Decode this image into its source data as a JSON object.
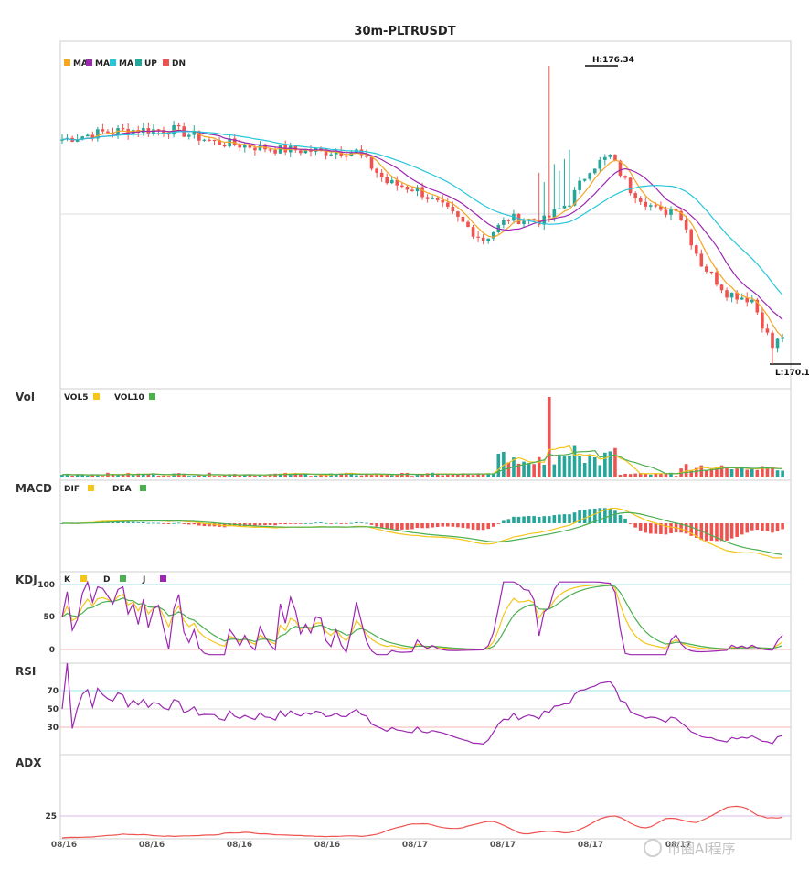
{
  "chart_data": {
    "type": "candlestick",
    "title": "30m-PLTRUSDT",
    "main_legend": [
      {
        "label": "MA",
        "color": "#f5a623"
      },
      {
        "label": "MA",
        "color": "#9c27b0"
      },
      {
        "label": "MA",
        "color": "#26c6da"
      },
      {
        "label": "UP",
        "color": "#26a69a"
      },
      {
        "label": "DN",
        "color": "#ef5350"
      }
    ],
    "high_label": "H:176.34",
    "low_label": "L:170.1",
    "price_high": 176.34,
    "price_low": 170.1,
    "anchor_prices": [
      [
        0,
        174.8
      ],
      [
        8,
        174.95
      ],
      [
        14,
        175.0
      ],
      [
        22,
        175.0
      ],
      [
        30,
        174.75
      ],
      [
        42,
        174.6
      ],
      [
        52,
        174.55
      ],
      [
        58,
        174.55
      ],
      [
        64,
        173.9
      ],
      [
        70,
        173.75
      ],
      [
        76,
        173.3
      ],
      [
        83,
        172.7
      ],
      [
        88,
        173.15
      ],
      [
        95,
        173.1
      ],
      [
        100,
        173.5
      ],
      [
        104,
        174.2
      ],
      [
        108,
        174.45
      ],
      [
        112,
        173.75
      ],
      [
        118,
        173.25
      ],
      [
        121,
        173.4
      ],
      [
        126,
        172.2
      ],
      [
        131,
        171.6
      ],
      [
        136,
        171.45
      ],
      [
        140,
        170.45
      ],
      [
        142,
        170.7
      ]
    ],
    "volume_spike_index": 96,
    "dates": [
      "08/16",
      "08/16",
      "08/16",
      "08/16",
      "08/17",
      "08/17",
      "08/17",
      "08/17"
    ],
    "panels": {
      "vol": {
        "label": "Vol",
        "legend": [
          {
            "label": "VOL5",
            "color": "#f5c518"
          },
          {
            "label": "VOL10",
            "color": "#4caf50"
          }
        ]
      },
      "macd": {
        "label": "MACD",
        "legend": [
          {
            "label": "DIF",
            "color": "#f5c518"
          },
          {
            "label": "DEA",
            "color": "#4caf50"
          }
        ]
      },
      "kdj": {
        "label": "KDJ",
        "legend": [
          {
            "label": "K",
            "color": "#f5c518"
          },
          {
            "label": "D",
            "color": "#4caf50"
          },
          {
            "label": "J",
            "color": "#9c27b0"
          }
        ],
        "ticks": [
          "100",
          "50",
          "0"
        ]
      },
      "rsi": {
        "label": "RSI",
        "ticks": [
          "70",
          "50",
          "30"
        ]
      },
      "adx": {
        "label": "ADX",
        "ticks": [
          "25"
        ]
      }
    }
  },
  "watermark": "币圈AI程序"
}
